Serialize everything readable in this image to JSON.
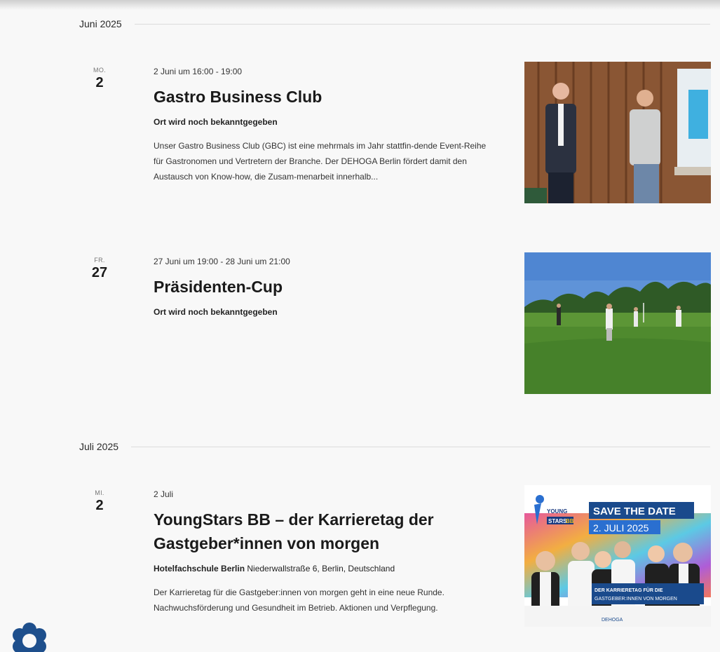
{
  "months": [
    {
      "label": "Juni 2025"
    },
    {
      "label": "Juli 2025"
    }
  ],
  "events": [
    {
      "dow": "MO.",
      "day": "2",
      "time": "2 Juni um 16:00 - 19:00",
      "title": "Gastro Business Club",
      "venue_name": "Ort wird noch bekanntgegeben",
      "venue_address": "",
      "description": "Unser Gastro Business Club (GBC) ist eine mehrmals im Jahr stattfin-dende Event-Reihe für Gastronomen und Vertretern der Branche. Der DEHOGA Berlin fördert damit den Austausch von Know-how, die Zusam-menarbeit innerhalb..."
    },
    {
      "dow": "FR.",
      "day": "27",
      "time": "27 Juni um 19:00 - 28 Juni um 21:00",
      "title": "Präsidenten-Cup",
      "venue_name": "Ort wird noch bekanntgegeben",
      "venue_address": "",
      "description": ""
    },
    {
      "dow": "MI.",
      "day": "2",
      "time": "2 Juli",
      "title": "YoungStars BB – der Karrieretag der Gastgeber*innen von morgen",
      "venue_name": "Hotelfachschule Berlin",
      "venue_address": "Niederwallstraße 6, Berlin, Deutschland",
      "description": "Der Karrieretag für die Gastgeber:innen von morgen geht in eine neue Runde. Nachwuchsförderung und Gesundheit im Betrieb. Aktionen und Verpflegung."
    }
  ],
  "poster": {
    "logo_text": "YOUNG",
    "logo_stars": "STARS",
    "logo_bb": "BB",
    "headline": "SAVE THE DATE",
    "date": "2. JULI 2025",
    "banner_line1": "DER KARRIERETAG FÜR DIE",
    "banner_line2": "GASTGEBER:INNEN VON MORGEN",
    "sponsor": "DEHOGA"
  },
  "icons": {
    "feedback": "flower-icon"
  }
}
